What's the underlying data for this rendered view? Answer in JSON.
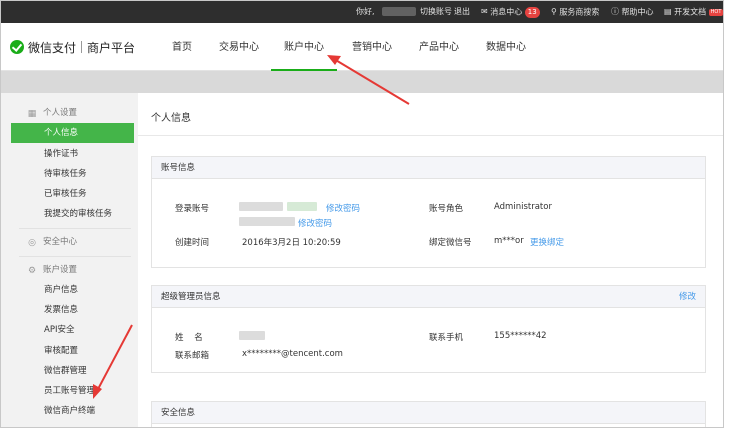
{
  "topbar": {
    "greeting": "你好,",
    "switch_account": "切换账号",
    "logout": "退出",
    "messages": "消息中心",
    "messages_count": "13",
    "service_search": "服务商搜索",
    "help": "帮助中心",
    "dev_docs": "开发文档",
    "hot": "HOT"
  },
  "brand": {
    "name": "微信支付",
    "platform": "商户平台"
  },
  "nav": [
    "首页",
    "交易中心",
    "账户中心",
    "营销中心",
    "产品中心",
    "数据中心"
  ],
  "nav_active": "账户中心",
  "sidebar": {
    "group1": "个人设置",
    "group1_items": [
      "个人信息",
      "操作证书",
      "待审核任务",
      "已审核任务",
      "我提交的审核任务"
    ],
    "group2": "安全中心",
    "group3": "账户设置",
    "group3_items": [
      "商户信息",
      "发票信息",
      "API安全",
      "审核配置",
      "微信群管理",
      "员工账号管理",
      "微信商户终端"
    ]
  },
  "page_title": "个人信息",
  "account_card": {
    "title": "账号信息",
    "login_label": "登录账号",
    "change_pwd": "修改密码",
    "change_pwd2": "修改密码",
    "role_label": "账号角色",
    "role_value": "Administrator",
    "created_label": "创建时间",
    "created_value": "2016年3月2日 10:20:59",
    "wechat_label": "绑定微信号",
    "wechat_value": "m***or",
    "rebind": "更换绑定"
  },
  "admin_card": {
    "title": "超级管理员信息",
    "edit": "修改",
    "name_label": "姓    名",
    "phone_label": "联系手机",
    "phone_value": "155******42",
    "email_label": "联系邮箱",
    "email_value": "x********@tencent.com"
  },
  "security_card": {
    "title": "安全信息"
  },
  "colors": {
    "accent": "#1aad19",
    "link": "#459ae9",
    "annotation": "#e53935"
  }
}
